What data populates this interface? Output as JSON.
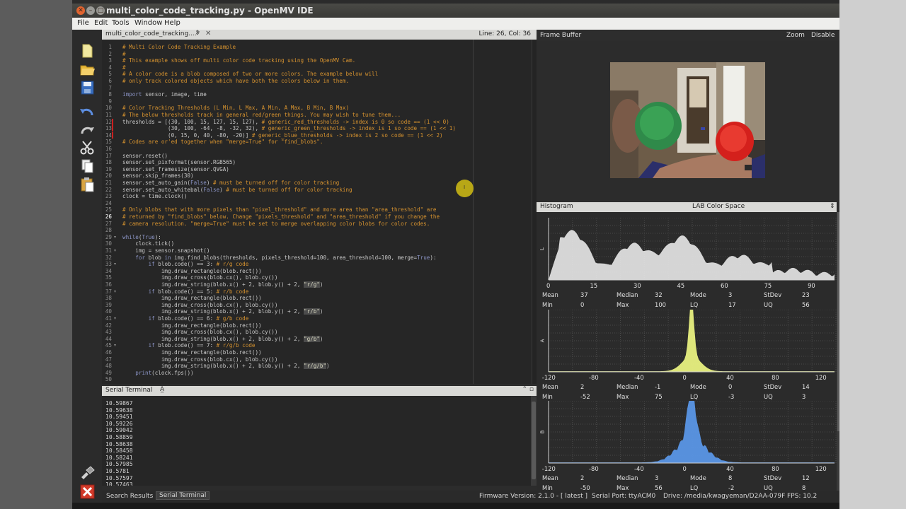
{
  "window": {
    "title": "multi_color_code_tracking.py - OpenMV IDE"
  },
  "menu": [
    "File",
    "Edit",
    "Tools",
    "Window",
    "Help"
  ],
  "editor": {
    "tab": "multi_color_code_tracking....*",
    "line_col": "Line: 26, Col: 36",
    "code_lines": [
      "# Multi Color Code Tracking Example",
      "#",
      "# This example shows off multi color code tracking using the OpenMV Cam.",
      "#",
      "# A color code is a blob composed of two or more colors. The example below will",
      "# only track colored objects which have both the colors below in them.",
      "",
      "import sensor, image, time",
      "",
      "# Color Tracking Thresholds (L Min, L Max, A Min, A Max, B Min, B Max)",
      "# The below thresholds track in general red/green things. You may wish to tune them...",
      "thresholds = [(30, 100, 15, 127, 15, 127), # generic_red_thresholds -> index is 0 so code == (1 << 0)",
      "              (30, 100, -64, -8, -32, 32), # generic_green_thresholds -> index is 1 so code == (1 << 1)",
      "              (0, 15, 0, 40, -80, -20)] # generic_blue_thresholds -> index is 2 so code == (1 << 2)",
      "# Codes are or'ed together when \"merge=True\" for \"find_blobs\".",
      "",
      "sensor.reset()",
      "sensor.set_pixformat(sensor.RGB565)",
      "sensor.set_framesize(sensor.QVGA)",
      "sensor.skip_frames(30)",
      "sensor.set_auto_gain(False) # must be turned off for color tracking",
      "sensor.set_auto_whitebal(False) # must be turned off for color tracking",
      "clock = time.clock()",
      "",
      "# Only blobs that with more pixels than \"pixel_threshold\" and more area than \"area_threshold\" are",
      "# returned by \"find_blobs\" below. Change \"pixels_threshold\" and \"area_threshold\" if you change the",
      "# camera resolution. \"merge=True\" must be set to merge overlapping color blobs for color codes.",
      "",
      "while(True):",
      "    clock.tick()",
      "    img = sensor.snapshot()",
      "    for blob in img.find_blobs(thresholds, pixels_threshold=100, area_threshold=100, merge=True):",
      "        if blob.code() == 3: # r/g code",
      "            img.draw_rectangle(blob.rect())",
      "            img.draw_cross(blob.cx(), blob.cy())",
      "            img.draw_string(blob.x() + 2, blob.y() + 2, \"r/g\")",
      "        if blob.code() == 5: # r/b code",
      "            img.draw_rectangle(blob.rect())",
      "            img.draw_cross(blob.cx(), blob.cy())",
      "            img.draw_string(blob.x() + 2, blob.y() + 2, \"r/b\")",
      "        if blob.code() == 6: # g/b code",
      "            img.draw_rectangle(blob.rect())",
      "            img.draw_cross(blob.cx(), blob.cy())",
      "            img.draw_string(blob.x() + 2, blob.y() + 2, \"g/b\")",
      "        if blob.code() == 7: # r/g/b code",
      "            img.draw_rectangle(blob.rect())",
      "            img.draw_cross(blob.cx(), blob.cy())",
      "            img.draw_string(blob.x() + 2, blob.y() + 2, \"r/g/b\")",
      "    print(clock.fps())",
      ""
    ]
  },
  "terminal": {
    "title": "Serial Terminal",
    "lines": [
      "10.59867",
      "10.59638",
      "10.59451",
      "10.59226",
      "10.59042",
      "10.58859",
      "10.58638",
      "10.58458",
      "10.58241",
      "10.57985",
      "10.5781",
      "10.57597",
      "10.57463"
    ]
  },
  "status": {
    "search_results": "Search Results",
    "serial_terminal": "Serial Terminal",
    "firmware": "Firmware Version: 2.1.0 - [ latest ]",
    "serial_port": "Serial Port: ttyACM0",
    "drive": "Drive: /media/kwagyeman/D2AA-079F",
    "fps": "FPS: 10.2"
  },
  "framebuffer": {
    "title": "Frame Buffer",
    "zoom": "Zoom",
    "disable": "Disable"
  },
  "histogram": {
    "title": "Histogram",
    "color_space": "LAB Color Space",
    "stat_labels": [
      "Mean",
      "Median",
      "Mode",
      "StDev",
      "Min",
      "Max",
      "LQ",
      "UQ"
    ],
    "channels": [
      {
        "name": "L",
        "color": "#e8e8e8",
        "ticks": [
          "0",
          "15",
          "30",
          "45",
          "60",
          "75",
          "90"
        ],
        "stats": {
          "mean": "37",
          "median": "32",
          "mode": "3",
          "stdev": "23",
          "min": "0",
          "max": "100",
          "lq": "17",
          "uq": "56"
        }
      },
      {
        "name": "A",
        "color": "#e8f080",
        "ticks": [
          "-120",
          "-80",
          "-40",
          "0",
          "40",
          "80",
          "120"
        ],
        "stats": {
          "mean": "2",
          "median": "-1",
          "mode": "0",
          "stdev": "14",
          "min": "-52",
          "max": "75",
          "lq": "-3",
          "uq": "3"
        }
      },
      {
        "name": "B",
        "color": "#5a96e6",
        "ticks": [
          "-120",
          "-80",
          "-40",
          "0",
          "40",
          "80",
          "120"
        ],
        "stats": {
          "mean": "2",
          "median": "3",
          "mode": "8",
          "stdev": "12",
          "min": "-50",
          "max": "56",
          "lq": "-2",
          "uq": "8"
        }
      }
    ]
  }
}
